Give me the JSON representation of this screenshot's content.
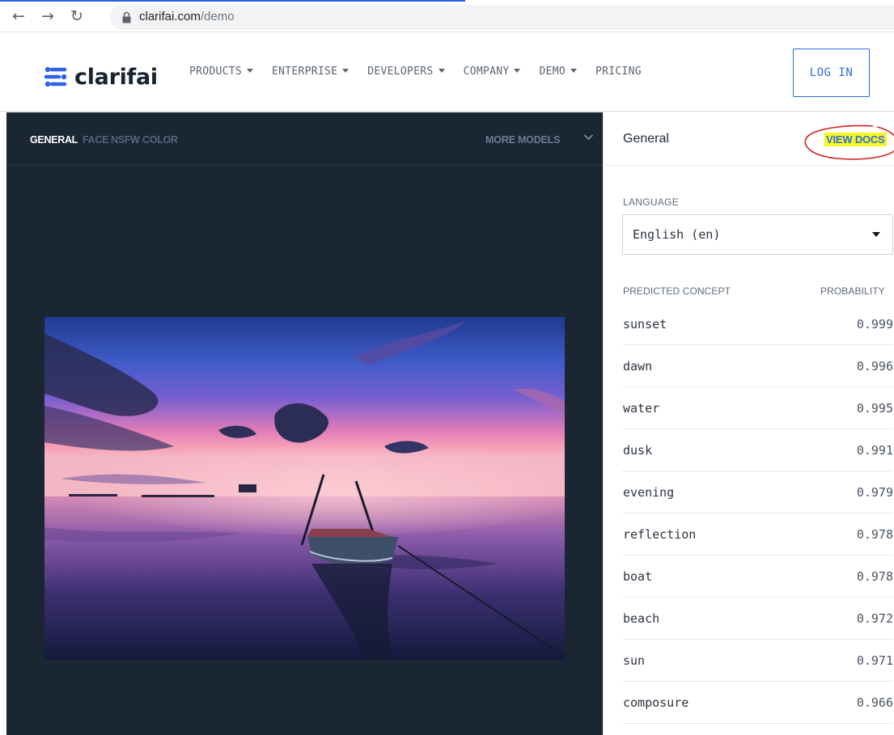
{
  "browser": {
    "url_domain": "clarifai.com",
    "url_path": "/demo"
  },
  "header": {
    "logo_text": "clarifai",
    "nav": [
      {
        "label": "PRODUCTS",
        "has_caret": true
      },
      {
        "label": "ENTERPRISE",
        "has_caret": true
      },
      {
        "label": "DEVELOPERS",
        "has_caret": true
      },
      {
        "label": "COMPANY",
        "has_caret": true
      },
      {
        "label": "DEMO",
        "has_caret": true
      },
      {
        "label": "PRICING",
        "has_caret": false
      }
    ],
    "login_label": "LOG IN"
  },
  "demo": {
    "tabs": [
      {
        "label": "GENERAL",
        "active": true
      },
      {
        "label": "FACE",
        "active": false
      },
      {
        "label": "NSFW",
        "active": false
      },
      {
        "label": "COLOR",
        "active": false
      }
    ],
    "more_models_label": "MORE MODELS"
  },
  "results": {
    "title": "General",
    "view_docs_label": "VIEW DOCS",
    "language_label": "LANGUAGE",
    "language_value": "English (en)",
    "concept_header": "PREDICTED CONCEPT",
    "probability_header": "PROBABILITY",
    "concepts": [
      {
        "name": "sunset",
        "probability": "0.999"
      },
      {
        "name": "dawn",
        "probability": "0.996"
      },
      {
        "name": "water",
        "probability": "0.995"
      },
      {
        "name": "dusk",
        "probability": "0.991"
      },
      {
        "name": "evening",
        "probability": "0.979"
      },
      {
        "name": "reflection",
        "probability": "0.978"
      },
      {
        "name": "boat",
        "probability": "0.978"
      },
      {
        "name": "beach",
        "probability": "0.972"
      },
      {
        "name": "sun",
        "probability": "0.971"
      },
      {
        "name": "composure",
        "probability": "0.966"
      }
    ]
  },
  "colors": {
    "accent_blue": "#2e6bd9",
    "panel_dark": "#1b2633",
    "highlight_yellow": "#f7f722",
    "annotation_red": "#d42020"
  }
}
